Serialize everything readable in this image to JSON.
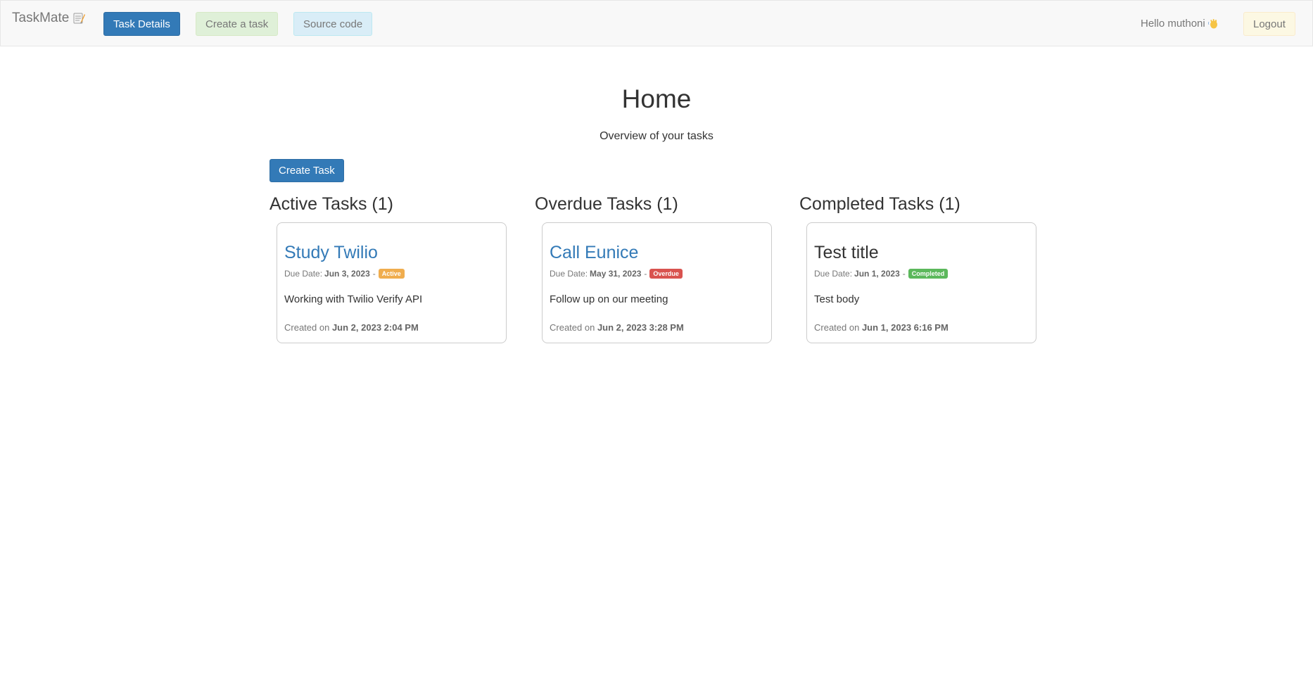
{
  "navbar": {
    "brand": "TaskMate",
    "brand_icon": "memo-icon",
    "task_details": "Task Details",
    "create_task": "Create a task",
    "source_code": "Source code",
    "greeting": "Hello muthoni",
    "greeting_icon": "waving-hand-icon",
    "logout": "Logout"
  },
  "main": {
    "title": "Home",
    "subtitle": "Overview of your tasks",
    "create_button": "Create Task"
  },
  "columns": {
    "active": {
      "heading": "Active Tasks (1)",
      "task": {
        "title": "Study Twilio",
        "due_label": "Due Date:",
        "due_date": "Jun 3, 2023",
        "separator": "-",
        "status": "Active",
        "body": "Working with Twilio Verify API",
        "created_label": "Created on",
        "created_at": "Jun 2, 2023 2:04 PM"
      }
    },
    "overdue": {
      "heading": "Overdue Tasks (1)",
      "task": {
        "title": "Call Eunice",
        "due_label": "Due Date:",
        "due_date": "May 31, 2023",
        "separator": "-",
        "status": "Overdue",
        "body": "Follow up on our meeting",
        "created_label": "Created on",
        "created_at": "Jun 2, 2023 3:28 PM"
      }
    },
    "completed": {
      "heading": "Completed Tasks (1)",
      "task": {
        "title": "Test title",
        "due_label": "Due Date:",
        "due_date": "Jun 1, 2023",
        "separator": "-",
        "status": "Completed",
        "body": "Test body",
        "created_label": "Created on",
        "created_at": "Jun 1, 2023 6:16 PM"
      }
    }
  },
  "colors": {
    "primary": "#337ab7",
    "active_badge": "#f0ad4e",
    "overdue_badge": "#d9534f",
    "completed_badge": "#5cb85c"
  }
}
